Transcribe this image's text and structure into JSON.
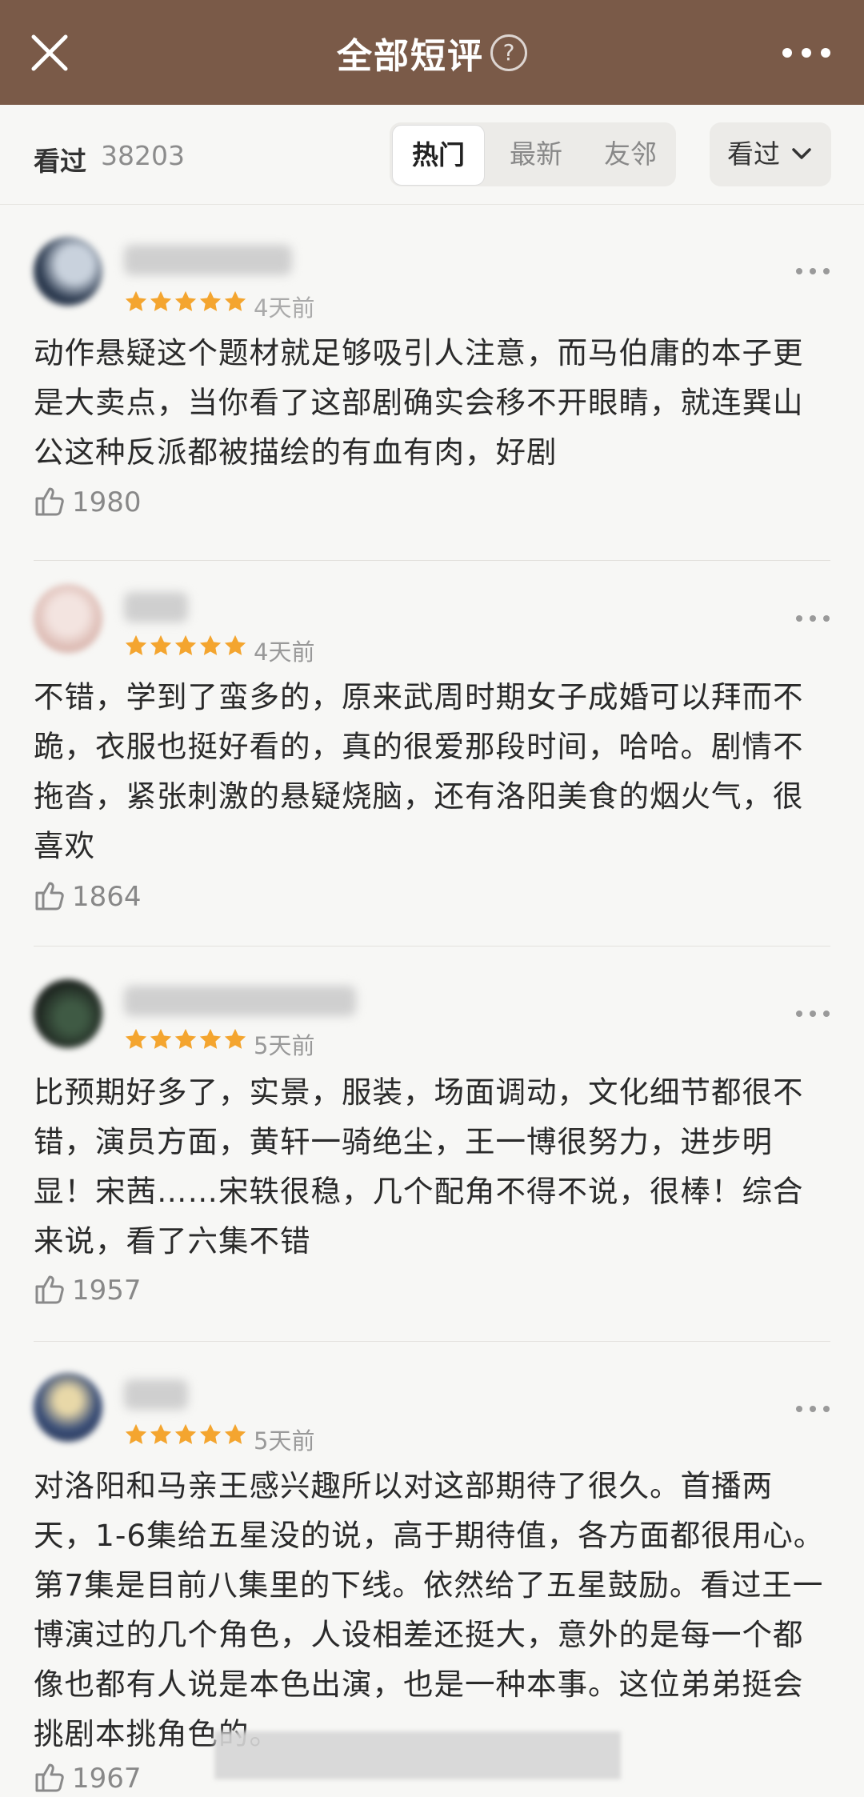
{
  "header": {
    "title": "全部短评",
    "help_glyph": "?"
  },
  "filter": {
    "watched_label": "看过",
    "watched_count": "38203",
    "tabs": [
      {
        "label": "热门",
        "active": true
      },
      {
        "label": "最新",
        "active": false
      },
      {
        "label": "友邻",
        "active": false
      }
    ],
    "dropdown_label": "看过"
  },
  "colors": {
    "header_bg": "#7a5a48",
    "star": "#f4a52f",
    "page_bg": "#f7f7f5"
  },
  "reviews": [
    {
      "rating": 5,
      "date": "4天前",
      "text": "动作悬疑这个题材就足够吸引人注意，而马伯庸的本子更是大卖点，当你看了这部剧确实会移不开眼睛，就连巽山公这种反派都被描绘的有血有肉，好剧",
      "likes": "1980"
    },
    {
      "rating": 5,
      "date": "4天前",
      "text": "不错，学到了蛮多的，原来武周时期女子成婚可以拜而不跪，衣服也挺好看的，真的很爱那段时间，哈哈。剧情不拖沓，紧张刺激的悬疑烧脑，还有洛阳美食的烟火气，很喜欢",
      "likes": "1864"
    },
    {
      "rating": 5,
      "date": "5天前",
      "text": "比预期好多了，实景，服装，场面调动，文化细节都很不错，演员方面，黄轩一骑绝尘，王一博很努力，进步明显！宋茜……宋轶很稳，几个配角不得不说，很棒！综合来说，看了六集不错",
      "likes": "1957"
    },
    {
      "rating": 5,
      "date": "5天前",
      "text": "对洛阳和马亲王感兴趣所以对这部期待了很久。首播两天，1-6集给五星没的说，高于期待值，各方面都很用心。第7集是目前八集里的下线。依然给了五星鼓励。看过王一博演过的几个角色，人设相差还挺大，意外的是每一个都像也都有人说是本色出演，也是一种本事。这位弟弟挺会挑剧本挑角色的。",
      "likes": "1967"
    }
  ]
}
